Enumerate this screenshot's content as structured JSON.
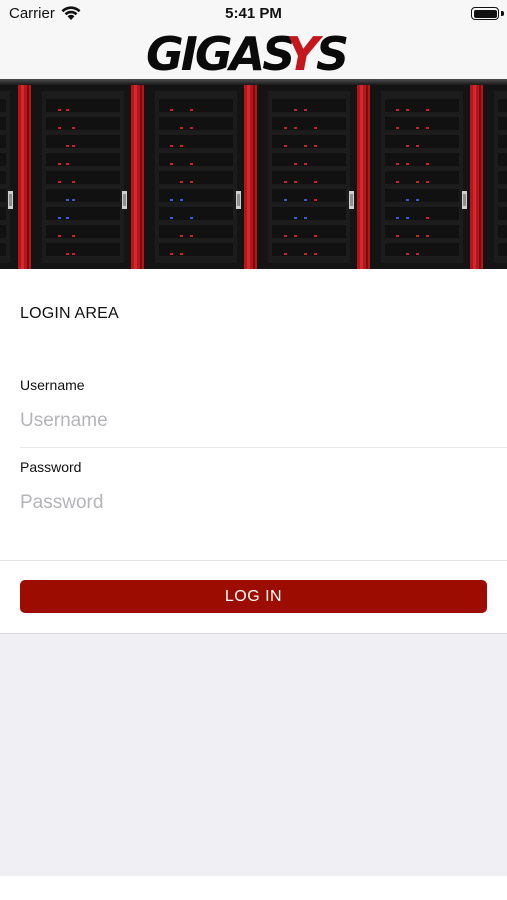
{
  "status_bar": {
    "carrier": "Carrier",
    "time": "5:41 PM",
    "wifi_icon": "wifi-icon",
    "battery_icon": "battery-icon"
  },
  "header": {
    "logo_text_black": "GIGAS",
    "logo_text_red": "Y",
    "logo_text_black2": "S"
  },
  "banner": {
    "image": "server-racks-banner"
  },
  "login": {
    "title": "LOGIN AREA",
    "username_label": "Username",
    "username_placeholder": "Username",
    "username_value": "",
    "password_label": "Password",
    "password_placeholder": "Password",
    "password_value": "",
    "button_label": "LOG IN"
  },
  "colors": {
    "brand_red": "#9c0c00",
    "page_background": "#efeff4",
    "header_background": "#f7f7f7"
  }
}
